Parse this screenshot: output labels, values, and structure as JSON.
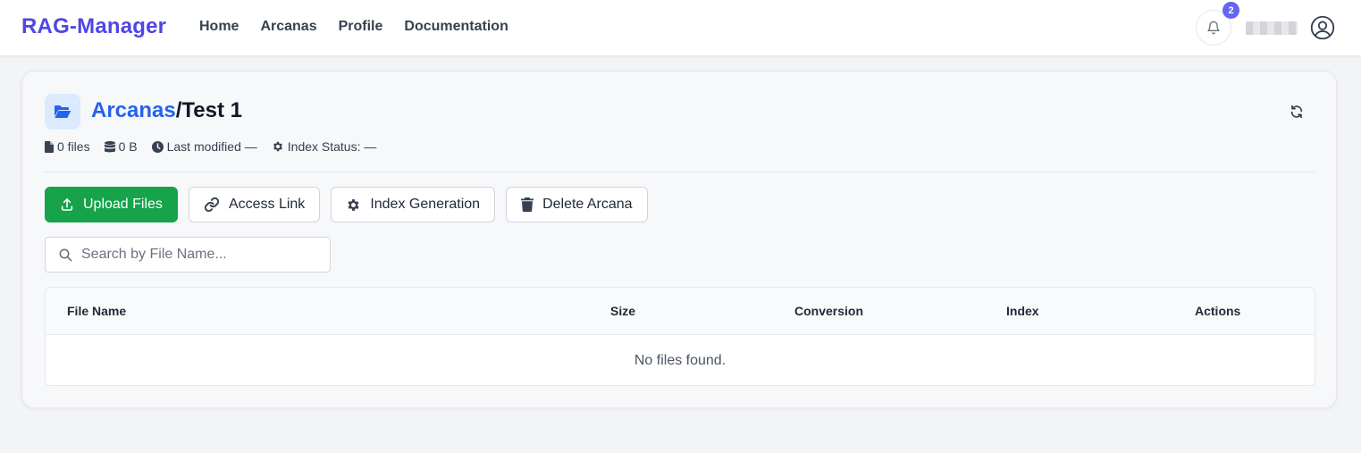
{
  "navbar": {
    "brand": "RAG-Manager",
    "links": [
      "Home",
      "Arcanas",
      "Profile",
      "Documentation"
    ],
    "notification_count": "2"
  },
  "colors": {
    "brand": "#4f46e5",
    "primary_button": "#16a34a",
    "link": "#2563eb",
    "badge": "#6366f1"
  },
  "header": {
    "breadcrumb_link": "Arcanas",
    "separator": "/",
    "current": "Test 1"
  },
  "meta": {
    "files": "0 files",
    "size": "0 B",
    "last_modified": "Last modified —",
    "index_status": "Index Status: —"
  },
  "actions": {
    "upload": "Upload Files",
    "access_link": "Access Link",
    "index_generation": "Index Generation",
    "delete": "Delete Arcana"
  },
  "search": {
    "placeholder": "Search by File Name..."
  },
  "table": {
    "columns": [
      "File Name",
      "Size",
      "Conversion",
      "Index",
      "Actions"
    ],
    "empty_message": "No files found."
  },
  "icons": [
    "bell-icon",
    "user-circle-icon",
    "folder-open-icon",
    "refresh-icon",
    "file-icon",
    "database-icon",
    "clock-icon",
    "gear-icon",
    "upload-icon",
    "link-icon",
    "trash-icon",
    "search-icon"
  ]
}
